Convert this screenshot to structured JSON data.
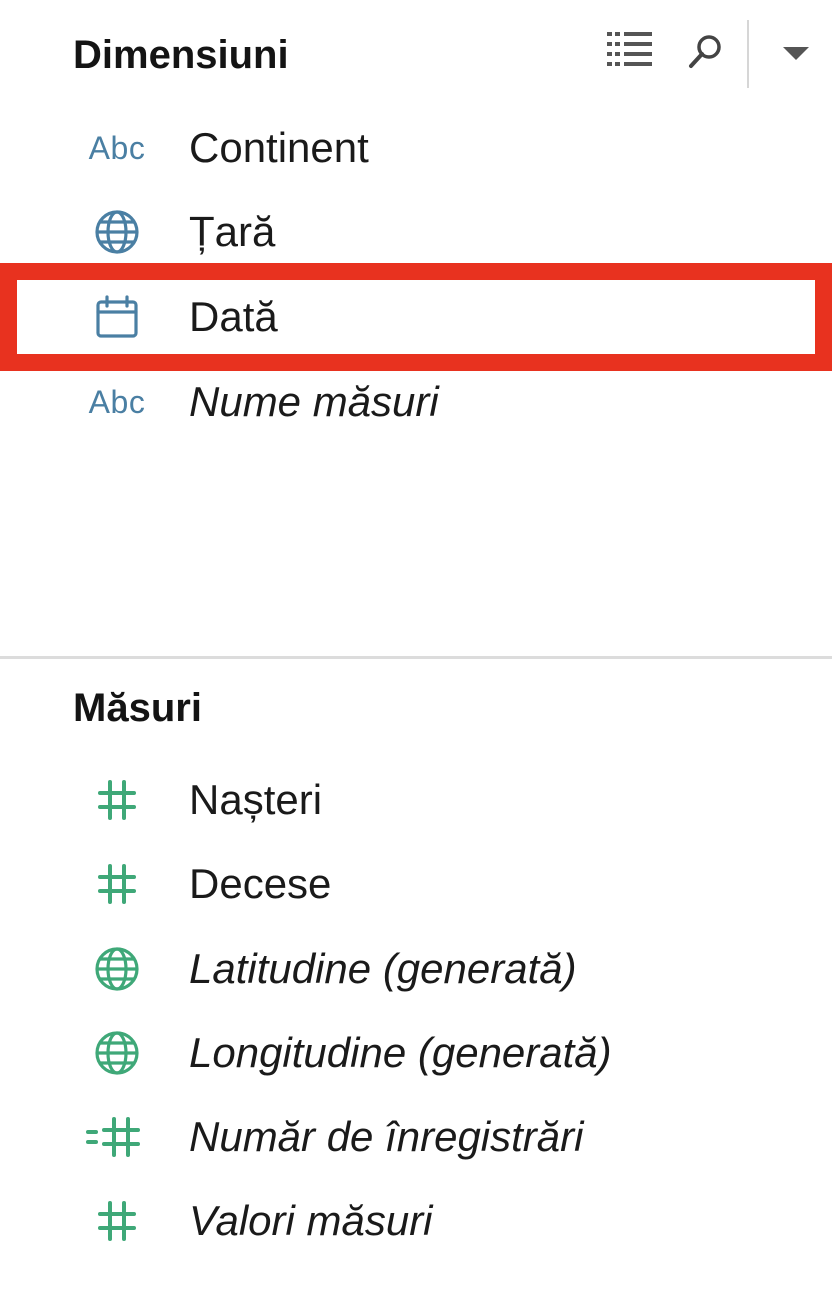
{
  "dimensions": {
    "title": "Dimensiuni",
    "toolbar": {
      "view_icon": "list-view-icon",
      "search_icon": "search-icon",
      "menu_icon": "dropdown-arrow-icon"
    },
    "items": [
      {
        "label": "Continent",
        "icon": "abc-string-icon",
        "icon_text": "Abc",
        "italic": false
      },
      {
        "label": "Țară",
        "icon": "globe-icon",
        "italic": false
      },
      {
        "label": "Dată",
        "icon": "calendar-icon",
        "italic": false,
        "highlighted": true
      },
      {
        "label": "Nume măsuri",
        "icon": "abc-string-icon",
        "icon_text": "Abc",
        "italic": true
      }
    ]
  },
  "measures": {
    "title": "Măsuri",
    "items": [
      {
        "label": "Nașteri",
        "icon": "number-icon",
        "italic": false
      },
      {
        "label": "Decese",
        "icon": "number-icon",
        "italic": false
      },
      {
        "label": "Latitudine (generată)",
        "icon": "globe-icon",
        "italic": true
      },
      {
        "label": "Longitudine (generată)",
        "icon": "globe-icon",
        "italic": true
      },
      {
        "label": "Număr de înregistrări",
        "icon": "calculated-number-icon",
        "italic": true
      },
      {
        "label": "Valori măsuri",
        "icon": "number-icon",
        "italic": true
      }
    ]
  },
  "colors": {
    "dimension_icon": "#4a7fa3",
    "measure_icon": "#3fa878",
    "highlight": "#e8321f"
  }
}
